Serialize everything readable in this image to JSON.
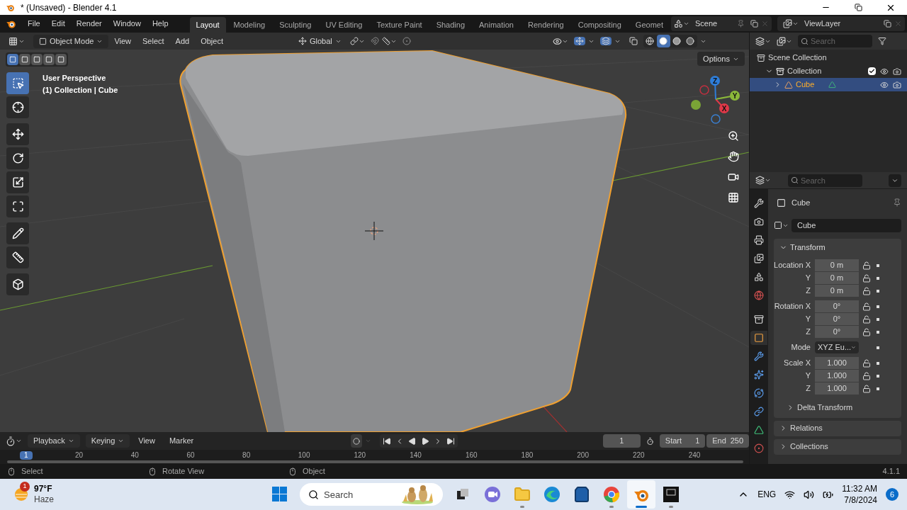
{
  "window": {
    "title": "* (Unsaved) - Blender 4.1"
  },
  "menu": [
    "File",
    "Edit",
    "Render",
    "Window",
    "Help"
  ],
  "workspaces": [
    {
      "label": "Layout",
      "selected": true
    },
    {
      "label": "Modeling",
      "selected": false
    },
    {
      "label": "Sculpting",
      "selected": false
    },
    {
      "label": "UV Editing",
      "selected": false
    },
    {
      "label": "Texture Paint",
      "selected": false
    },
    {
      "label": "Shading",
      "selected": false
    },
    {
      "label": "Animation",
      "selected": false
    },
    {
      "label": "Rendering",
      "selected": false
    },
    {
      "label": "Compositing",
      "selected": false
    },
    {
      "label": "Geomet",
      "selected": false
    }
  ],
  "scene": {
    "name": "Scene"
  },
  "view_layer": {
    "name": "ViewLayer"
  },
  "viewport": {
    "mode": "Object Mode",
    "menus": [
      "View",
      "Select",
      "Add",
      "Object"
    ],
    "orientation": "Global",
    "options": "Options",
    "overlay_lines": [
      "User Perspective",
      "(1) Collection | Cube"
    ],
    "select_modes": [
      {
        "selected": true
      },
      {
        "selected": false
      },
      {
        "selected": false
      },
      {
        "selected": false
      },
      {
        "selected": false
      }
    ],
    "shading": [
      {
        "kind": "wireframe",
        "selected": false
      },
      {
        "kind": "solid",
        "selected": true
      },
      {
        "kind": "material",
        "selected": false
      },
      {
        "kind": "rendered",
        "selected": false
      }
    ],
    "tools": [
      {
        "kind": "select",
        "selected": true
      },
      {
        "kind": "cursor",
        "selected": false
      },
      {
        "kind": "move",
        "selected": false
      },
      {
        "kind": "rotate",
        "selected": false
      },
      {
        "kind": "scale",
        "selected": false
      },
      {
        "kind": "transform",
        "selected": false
      },
      {
        "kind": "annotate",
        "selected": false
      },
      {
        "kind": "measure",
        "selected": false
      },
      {
        "kind": "add_cube",
        "selected": false
      }
    ],
    "gizmo": [
      "X",
      "Y",
      "Z"
    ]
  },
  "outliner": {
    "search": {
      "placeholder": "Search"
    },
    "items": [
      {
        "label": "Scene Collection",
        "kind": "scene",
        "selected": false,
        "children": [
          {
            "label": "Collection",
            "kind": "collection",
            "expanded": true,
            "checked": true,
            "selected": false,
            "children": [
              {
                "label": "Cube",
                "kind": "mesh",
                "expanded": false,
                "selected": true
              }
            ]
          }
        ]
      }
    ]
  },
  "properties": {
    "search": {
      "placeholder": "Search"
    },
    "tabs": [
      {
        "kind": "tool",
        "selected": false
      },
      {
        "kind": "render",
        "selected": false
      },
      {
        "kind": "output",
        "selected": false
      },
      {
        "kind": "view_layer",
        "selected": false
      },
      {
        "kind": "scene",
        "selected": false
      },
      {
        "kind": "world",
        "selected": false
      },
      {
        "kind": "collection",
        "selected": false
      },
      {
        "kind": "object",
        "selected": true
      },
      {
        "kind": "modifiers",
        "selected": false
      },
      {
        "kind": "particles",
        "selected": false
      },
      {
        "kind": "physics",
        "selected": false
      },
      {
        "kind": "constraints",
        "selected": false
      },
      {
        "kind": "data",
        "selected": false
      },
      {
        "kind": "material",
        "selected": false
      }
    ],
    "object_name": "Cube",
    "name_field": "Cube",
    "transform": {
      "title": "Transform",
      "expanded": true,
      "groups": [
        [
          {
            "label": "Location X",
            "value": "0 m",
            "kind": "number",
            "locked": false
          },
          {
            "label": "Y",
            "value": "0 m",
            "kind": "number",
            "locked": false
          },
          {
            "label": "Z",
            "value": "0 m",
            "kind": "number",
            "locked": false
          }
        ],
        [
          {
            "label": "Rotation X",
            "value": "0°",
            "kind": "number",
            "locked": false
          },
          {
            "label": "Y",
            "value": "0°",
            "kind": "number",
            "locked": false
          },
          {
            "label": "Z",
            "value": "0°",
            "kind": "number",
            "locked": false
          }
        ],
        [
          {
            "label": "Mode",
            "value": "XYZ Eu...",
            "kind": "dropdown"
          }
        ],
        [
          {
            "label": "Scale X",
            "value": "1.000",
            "kind": "number",
            "locked": false
          },
          {
            "label": "Y",
            "value": "1.000",
            "kind": "number",
            "locked": false
          },
          {
            "label": "Z",
            "value": "1.000",
            "kind": "number",
            "locked": false
          }
        ]
      ],
      "subpanel": {
        "title": "Delta Transform",
        "expanded": false
      }
    },
    "panels": [
      {
        "title": "Relations",
        "expanded": false
      },
      {
        "title": "Collections",
        "expanded": false
      }
    ]
  },
  "timeline": {
    "menus": [
      {
        "label": "Playback",
        "dropdown": true
      },
      {
        "label": "Keying",
        "dropdown": true
      },
      {
        "label": "View",
        "dropdown": false
      },
      {
        "label": "Marker",
        "dropdown": false
      }
    ],
    "auto_key": false,
    "current_frame": "1",
    "start_label": "Start",
    "start": "1",
    "end_label": "End",
    "end": "250",
    "playhead": "1",
    "ruler": [
      "20",
      "40",
      "60",
      "80",
      "100",
      "120",
      "140",
      "160",
      "180",
      "200",
      "220",
      "240"
    ]
  },
  "status_bar": {
    "hints": [
      "Select",
      "Rotate View",
      "Object"
    ],
    "version": "4.1.1"
  },
  "taskbar": {
    "weather": {
      "temp": "97°F",
      "condition": "Haze",
      "badge": "1"
    },
    "search": {
      "placeholder": "Search"
    },
    "apps": [
      {
        "kind": "task_view",
        "active": false,
        "running": false
      },
      {
        "kind": "video_chat",
        "active": false,
        "running": false
      },
      {
        "kind": "folder",
        "active": false,
        "running": true
      },
      {
        "kind": "edge",
        "active": false,
        "running": false
      },
      {
        "kind": "store",
        "active": false,
        "running": false
      },
      {
        "kind": "chrome",
        "active": false,
        "running": true
      },
      {
        "kind": "blender",
        "active": true,
        "running": true
      },
      {
        "kind": "screen",
        "active": false,
        "running": true
      }
    ],
    "language": "ENG",
    "time": "11:32 AM",
    "date": "7/8/2024",
    "notifications": "6"
  }
}
